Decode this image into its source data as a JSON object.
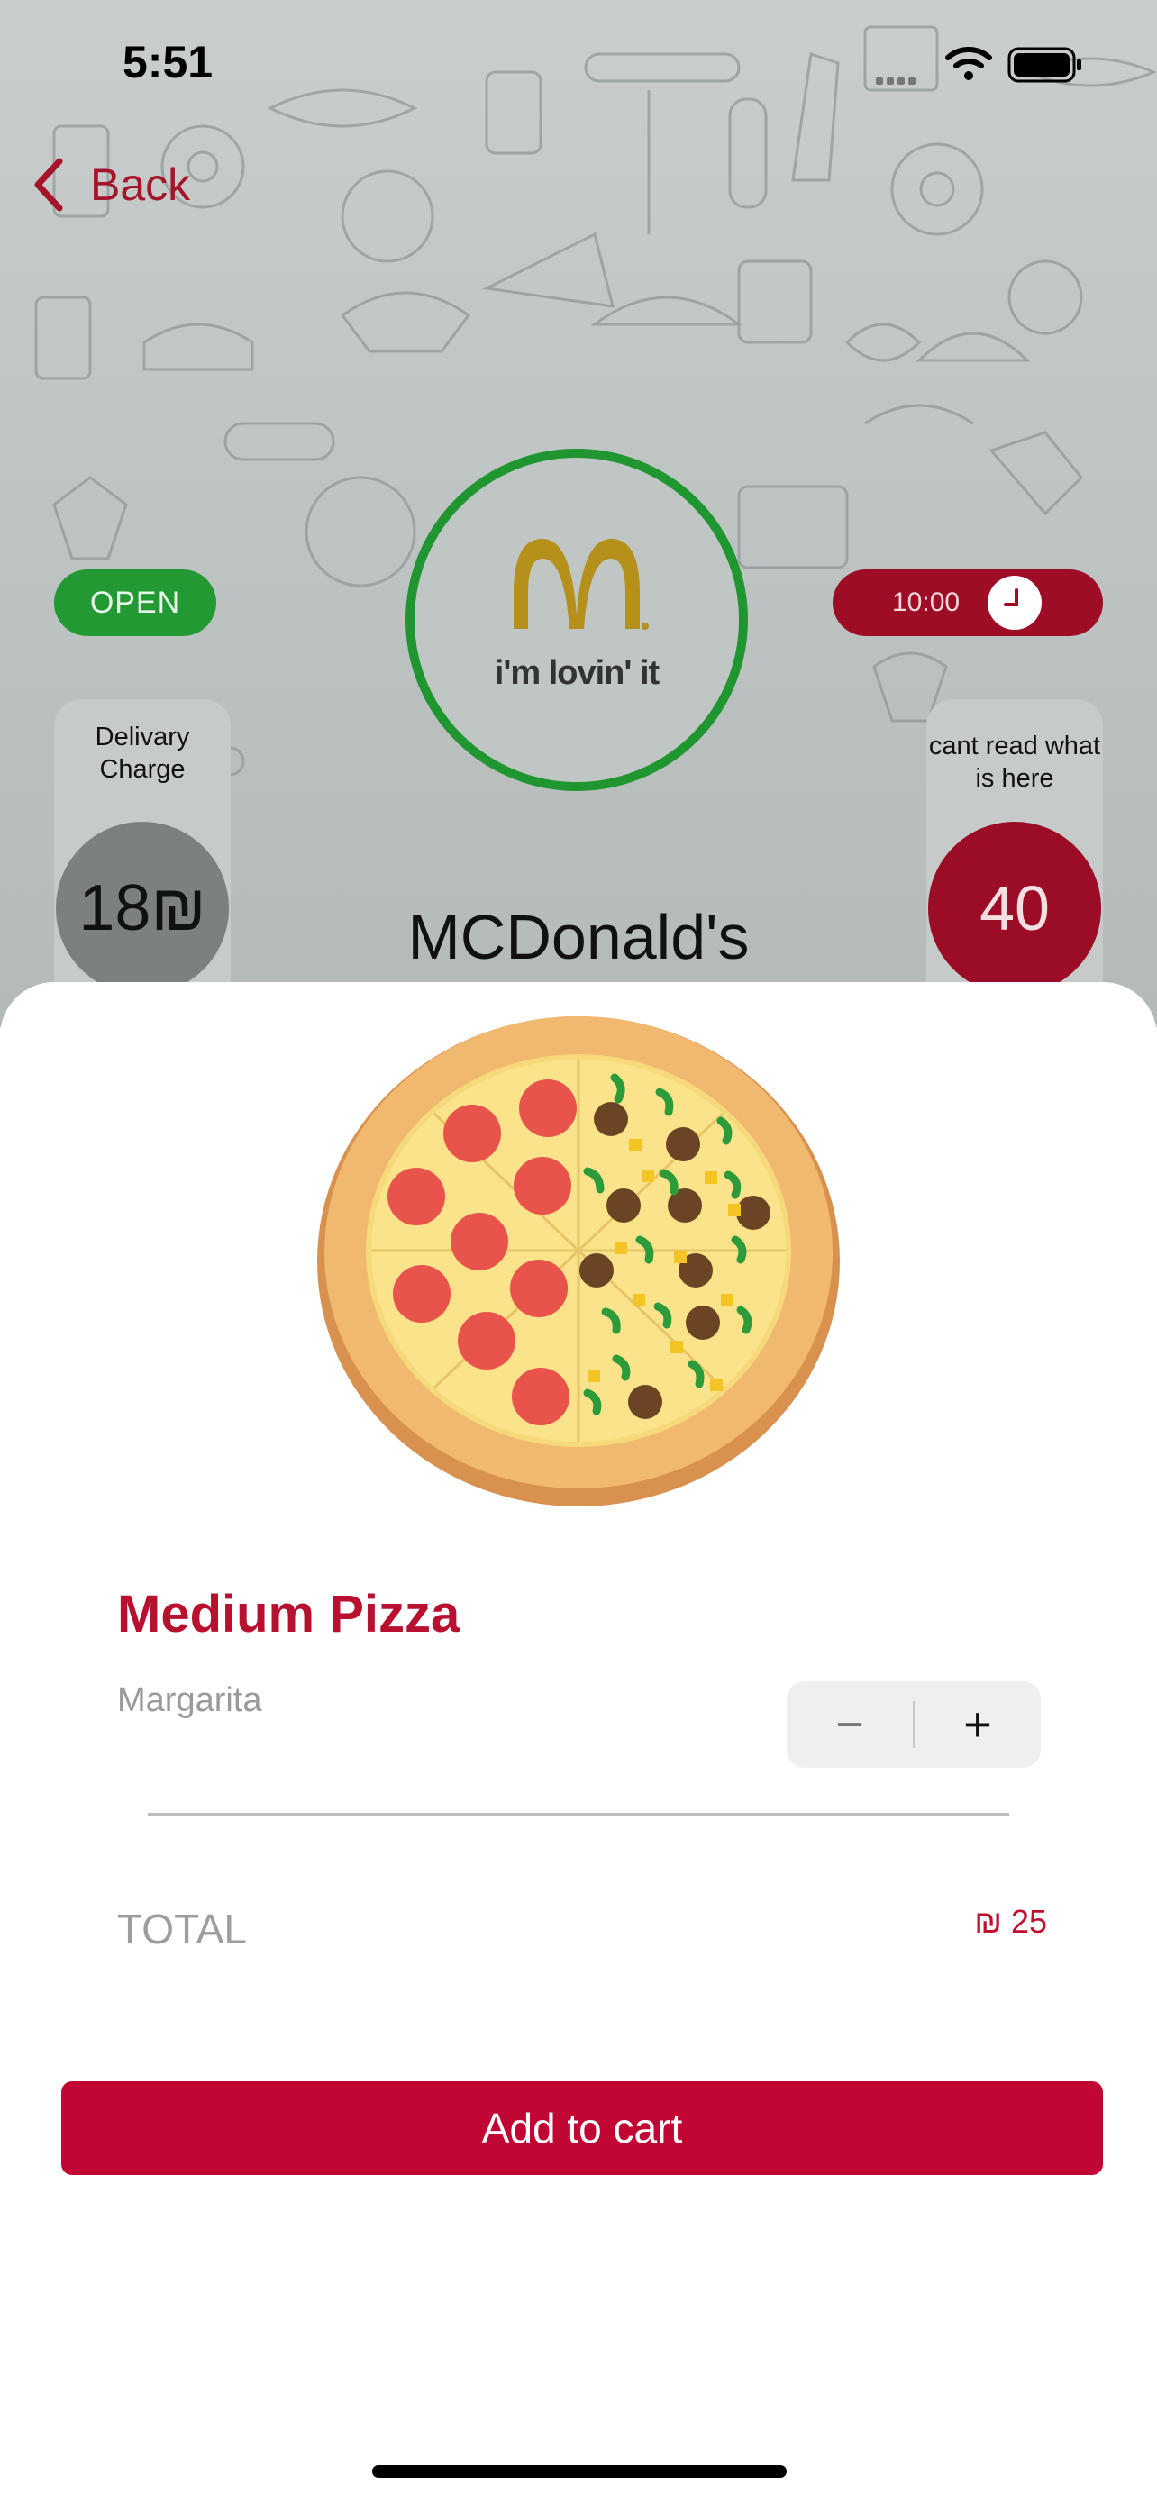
{
  "status": {
    "time": "5:51"
  },
  "nav": {
    "back_label": "Back"
  },
  "restaurant": {
    "name": "MCDonald's",
    "open_status": "OPEN",
    "hours": "10:00",
    "logo_tagline": "i'm lovin' it",
    "delivery_charge": {
      "label": "Delivary Charge",
      "value": "18₪"
    },
    "other_info": {
      "label": "cant read what is here",
      "value": "40"
    }
  },
  "item": {
    "title": "Medium Pizza",
    "subtitle": "Margarita",
    "minus_symbol": "−",
    "plus_symbol": "+"
  },
  "order": {
    "total_label": "TOTAL",
    "total_value": "₪ 25"
  },
  "actions": {
    "add_to_cart": "Add to cart"
  },
  "colors": {
    "brand_red": "#c10634",
    "open_green": "#229933",
    "logo_gold": "#b5901b"
  }
}
